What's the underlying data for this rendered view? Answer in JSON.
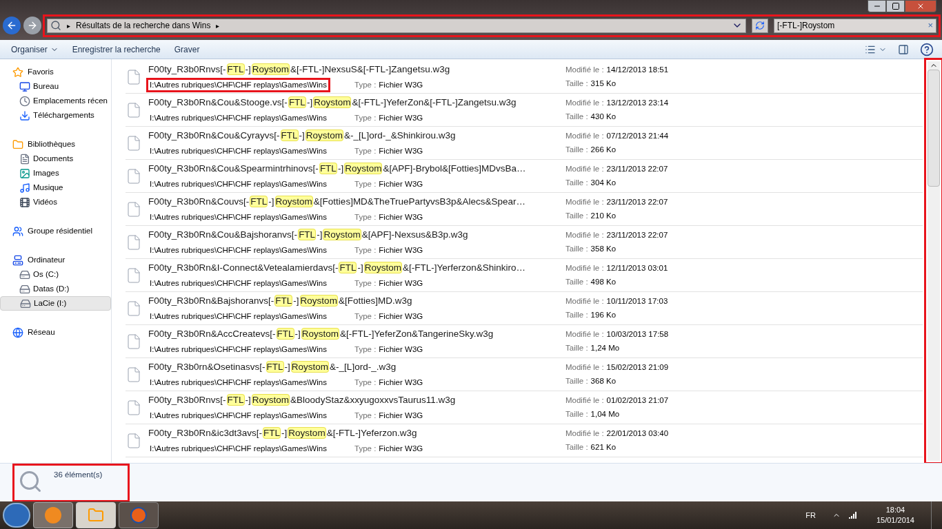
{
  "address_bar": {
    "crumbs": [
      "Résultats de la recherche dans Wins"
    ],
    "separator": "▸",
    "annotated": true
  },
  "search": {
    "value": "[-FTL-]Roystom",
    "clear": "×"
  },
  "toolbar": {
    "buttons": [
      {
        "label": "Organiser",
        "dropdown": true
      },
      {
        "label": "Enregistrer la recherche",
        "dropdown": false
      },
      {
        "label": "Graver",
        "dropdown": false
      }
    ]
  },
  "sidebar": {
    "groups": [
      {
        "label": "Favoris",
        "items": [
          {
            "label": "Bureau",
            "selected": false
          },
          {
            "label": "Emplacements récen",
            "selected": false
          },
          {
            "label": "Téléchargements",
            "selected": false
          }
        ]
      },
      {
        "label": "Bibliothèques",
        "items": [
          {
            "label": "Documents",
            "selected": false
          },
          {
            "label": "Images",
            "selected": false
          },
          {
            "label": "Musique",
            "selected": false
          },
          {
            "label": "Vidéos",
            "selected": false
          }
        ]
      },
      {
        "label": "Groupe résidentiel"
      },
      {
        "label": "Ordinateur",
        "items": [
          {
            "label": "Os (C:)",
            "selected": false
          },
          {
            "label": "Datas (D:)",
            "selected": false
          },
          {
            "label": "LaCie (I:)",
            "selected": true
          }
        ]
      },
      {
        "label": "Réseau"
      }
    ]
  },
  "results": {
    "scrollbar_annotated": true,
    "rows": [
      {
        "name": [
          {
            "text": "F00ty_R3b0Rnvs[-",
            "highlight": false
          },
          {
            "text": "FTL",
            "highlight": true
          },
          {
            "text": "-]",
            "highlight": false
          },
          {
            "text": "Roystom",
            "highlight": true
          },
          {
            "text": "&[-FTL-]NexsuS&[-FTL-]Zangetsu.w3g",
            "highlight": false
          }
        ],
        "path": "I:\\Autres rubriques\\CHF\\CHF replays\\Games\\Wins",
        "annotated": true,
        "type_label": "Type :",
        "type": "Fichier W3G",
        "modified_label": "Modifié le :",
        "modified": "14/12/2013 18:51",
        "size_label": "Taille :",
        "size": "315 Ko"
      },
      {
        "name": [
          {
            "text": "F00ty_R3b0Rn&Cou&Stooge.vs[-",
            "highlight": false
          },
          {
            "text": "FTL",
            "highlight": true
          },
          {
            "text": "-]",
            "highlight": false
          },
          {
            "text": "Roystom",
            "highlight": true
          },
          {
            "text": "&[-FTL-]YeferZon&[-FTL-]Zangetsu.w3g",
            "highlight": false
          }
        ],
        "path": "I:\\Autres rubriques\\CHF\\CHF replays\\Games\\Wins",
        "annotated": false,
        "type_label": "Type :",
        "type": "Fichier W3G",
        "modified_label": "Modifié le :",
        "modified": "13/12/2013 23:14",
        "size_label": "Taille :",
        "size": "430 Ko"
      },
      {
        "name": [
          {
            "text": "F00ty_R3b0Rn&Cou&Cyrayvs[-",
            "highlight": false
          },
          {
            "text": "FTL",
            "highlight": true
          },
          {
            "text": "-]",
            "highlight": false
          },
          {
            "text": "Roystom",
            "highlight": true
          },
          {
            "text": "&-_[L]ord-_&Shinkirou.w3g",
            "highlight": false
          }
        ],
        "path": "I:\\Autres rubriques\\CHF\\CHF replays\\Games\\Wins",
        "annotated": false,
        "type_label": "Type :",
        "type": "Fichier W3G",
        "modified_label": "Modifié le :",
        "modified": "07/12/2013 21:44",
        "size_label": "Taille :",
        "size": "266 Ko"
      },
      {
        "name": [
          {
            "text": "F00ty_R3b0Rn&Cou&Spearmintrhinovs[-",
            "highlight": false
          },
          {
            "text": "FTL",
            "highlight": true
          },
          {
            "text": "-]",
            "highlight": false
          },
          {
            "text": "Roystom",
            "highlight": true
          },
          {
            "text": "&[APF]-Brybol&[Fotties]MDvsBa…",
            "highlight": false
          }
        ],
        "path": "I:\\Autres rubriques\\CHF\\CHF replays\\Games\\Wins",
        "annotated": false,
        "type_label": "Type :",
        "type": "Fichier W3G",
        "modified_label": "Modifié le :",
        "modified": "23/11/2013 22:07",
        "size_label": "Taille :",
        "size": "304 Ko"
      },
      {
        "name": [
          {
            "text": "F00ty_R3b0Rn&Couvs[-",
            "highlight": false
          },
          {
            "text": "FTL",
            "highlight": true
          },
          {
            "text": "-]",
            "highlight": false
          },
          {
            "text": "Roystom",
            "highlight": true
          },
          {
            "text": "&[Fotties]MD&TheTruePartyvsB3p&Alecs&Spear…",
            "highlight": false
          }
        ],
        "path": "I:\\Autres rubriques\\CHF\\CHF replays\\Games\\Wins",
        "annotated": false,
        "type_label": "Type :",
        "type": "Fichier W3G",
        "modified_label": "Modifié le :",
        "modified": "23/11/2013 22:07",
        "size_label": "Taille :",
        "size": "210 Ko"
      },
      {
        "name": [
          {
            "text": "F00ty_R3b0Rn&Cou&Bajshoranvs[-",
            "highlight": false
          },
          {
            "text": "FTL",
            "highlight": true
          },
          {
            "text": "-]",
            "highlight": false
          },
          {
            "text": "Roystom",
            "highlight": true
          },
          {
            "text": "&[APF]-Nexsus&B3p.w3g",
            "highlight": false
          }
        ],
        "path": "I:\\Autres rubriques\\CHF\\CHF replays\\Games\\Wins",
        "annotated": false,
        "type_label": "Type :",
        "type": "Fichier W3G",
        "modified_label": "Modifié le :",
        "modified": "23/11/2013 22:07",
        "size_label": "Taille :",
        "size": "358 Ko"
      },
      {
        "name": [
          {
            "text": "F00ty_R3b0Rn&I-Connect&Vetealamierdavs[-",
            "highlight": false
          },
          {
            "text": "FTL",
            "highlight": true
          },
          {
            "text": "-]",
            "highlight": false
          },
          {
            "text": "Roystom",
            "highlight": true
          },
          {
            "text": "&[-FTL-]Yerferzon&Shinkiro…",
            "highlight": false
          }
        ],
        "path": "I:\\Autres rubriques\\CHF\\CHF replays\\Games\\Wins",
        "annotated": false,
        "type_label": "Type :",
        "type": "Fichier W3G",
        "modified_label": "Modifié le :",
        "modified": "12/11/2013 03:01",
        "size_label": "Taille :",
        "size": "498 Ko"
      },
      {
        "name": [
          {
            "text": "F00ty_R3b0Rn&Bajshoranvs[-",
            "highlight": false
          },
          {
            "text": "FTL",
            "highlight": true
          },
          {
            "text": "-]",
            "highlight": false
          },
          {
            "text": "Roystom",
            "highlight": true
          },
          {
            "text": "&[Fotties]MD.w3g",
            "highlight": false
          }
        ],
        "path": "I:\\Autres rubriques\\CHF\\CHF replays\\Games\\Wins",
        "annotated": false,
        "type_label": "Type :",
        "type": "Fichier W3G",
        "modified_label": "Modifié le :",
        "modified": "10/11/2013 17:03",
        "size_label": "Taille :",
        "size": "196 Ko"
      },
      {
        "name": [
          {
            "text": "F00ty_R3b0Rn&AccCreatevs[-",
            "highlight": false
          },
          {
            "text": "FTL",
            "highlight": true
          },
          {
            "text": "-]",
            "highlight": false
          },
          {
            "text": "Roystom",
            "highlight": true
          },
          {
            "text": "&[-FTL-]YeferZon&TangerineSky.w3g",
            "highlight": false
          }
        ],
        "path": "I:\\Autres rubriques\\CHF\\CHF replays\\Games\\Wins",
        "annotated": false,
        "type_label": "Type :",
        "type": "Fichier W3G",
        "modified_label": "Modifié le :",
        "modified": "10/03/2013 17:58",
        "size_label": "Taille :",
        "size": "1,24 Mo"
      },
      {
        "name": [
          {
            "text": "F00ty_R3b0rn&Osetinasvs[-",
            "highlight": false
          },
          {
            "text": "FTL",
            "highlight": true
          },
          {
            "text": "-]",
            "highlight": false
          },
          {
            "text": "Roystom",
            "highlight": true
          },
          {
            "text": "&-_[L]ord-_.w3g",
            "highlight": false
          }
        ],
        "path": "I:\\Autres rubriques\\CHF\\CHF replays\\Games\\Wins",
        "annotated": false,
        "type_label": "Type :",
        "type": "Fichier W3G",
        "modified_label": "Modifié le :",
        "modified": "15/02/2013 21:09",
        "size_label": "Taille :",
        "size": "368 Ko"
      },
      {
        "name": [
          {
            "text": "F00ty_R3b0Rnvs[-",
            "highlight": false
          },
          {
            "text": "FTL",
            "highlight": true
          },
          {
            "text": "-]",
            "highlight": false
          },
          {
            "text": "Roystom",
            "highlight": true
          },
          {
            "text": "&BloodyStaz&xxyugoxxvsTaurus11.w3g",
            "highlight": false
          }
        ],
        "path": "I:\\Autres rubriques\\CHF\\CHF replays\\Games\\Wins",
        "annotated": false,
        "type_label": "Type :",
        "type": "Fichier W3G",
        "modified_label": "Modifié le :",
        "modified": "01/02/2013 21:07",
        "size_label": "Taille :",
        "size": "1,04 Mo"
      },
      {
        "name": [
          {
            "text": "F00ty_R3b0Rn&ic3dt3avs[-",
            "highlight": false
          },
          {
            "text": "FTL",
            "highlight": true
          },
          {
            "text": "-]",
            "highlight": false
          },
          {
            "text": "Roystom",
            "highlight": true
          },
          {
            "text": "&[-FTL-]Yeferzon.w3g",
            "highlight": false
          }
        ],
        "path": "I:\\Autres rubriques\\CHF\\CHF replays\\Games\\Wins",
        "annotated": false,
        "type_label": "Type :",
        "type": "Fichier W3G",
        "modified_label": "Modifié le :",
        "modified": "22/01/2013 03:40",
        "size_label": "Taille :",
        "size": "621 Ko"
      }
    ]
  },
  "status_bar": {
    "count": "36 élément(s)",
    "annotated": true
  },
  "taskbar": {
    "language": "FR",
    "time": "18:04",
    "date": "15/01/2014"
  }
}
